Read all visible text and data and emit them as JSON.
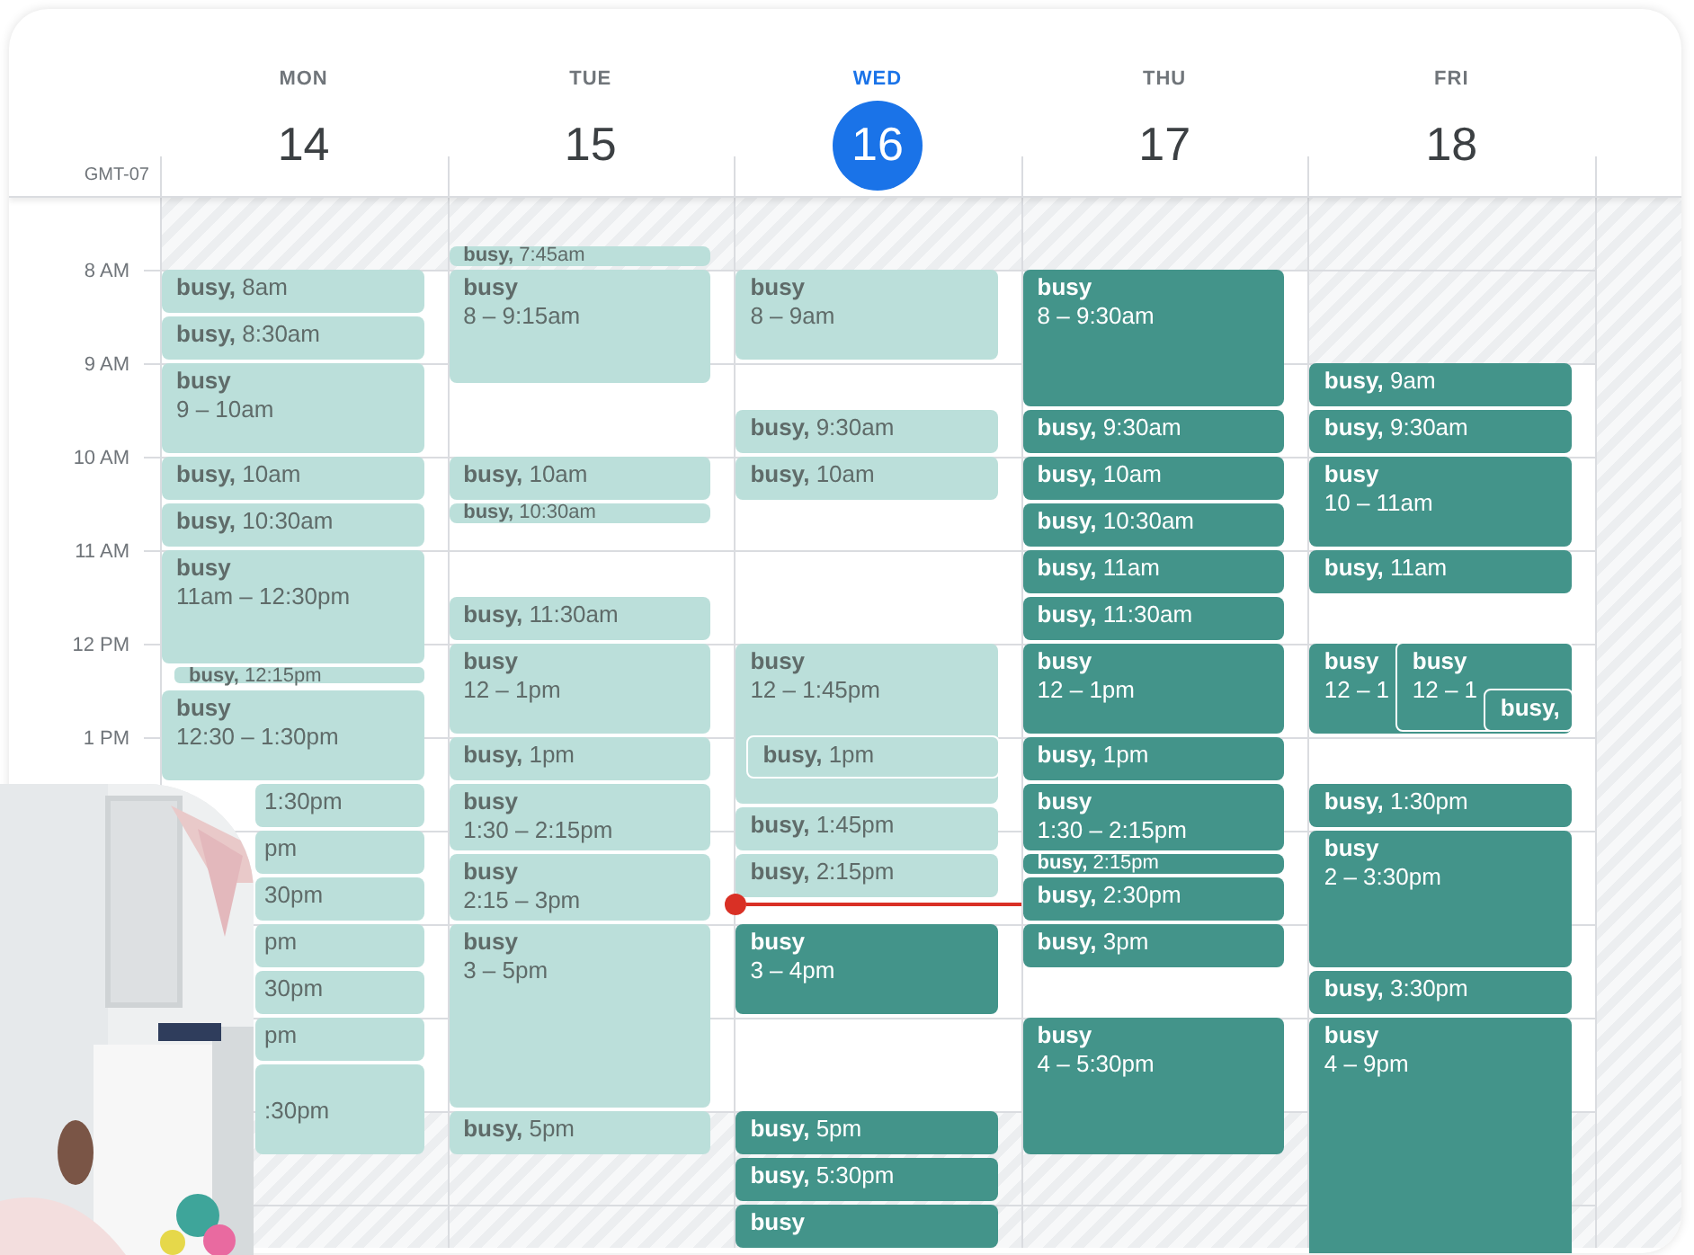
{
  "timezone": "GMT-07",
  "hours": [
    "8 AM",
    "9 AM",
    "10 AM",
    "11 AM",
    "12 PM",
    "1 PM"
  ],
  "days": [
    {
      "name": "MON",
      "date": "14",
      "selected": false,
      "events": [
        {
          "title": "busy,",
          "time": "8am",
          "past": true
        },
        {
          "title": "busy,",
          "time": "8:30am",
          "past": true
        },
        {
          "title": "busy",
          "time": "9 – 10am",
          "past": true
        },
        {
          "title": "busy,",
          "time": "10am",
          "past": true
        },
        {
          "title": "busy,",
          "time": "10:30am",
          "past": true
        },
        {
          "title": "busy",
          "time": "11am – 12:30pm",
          "past": true,
          "children": [
            {
              "title": "busy,",
              "time": "12:15pm",
              "past": true
            }
          ]
        },
        {
          "title": "busy",
          "time": "12:30 – 1:30pm",
          "past": true
        },
        {
          "time": "1:30pm",
          "past": true,
          "covered": true
        },
        {
          "time": "pm",
          "past": true,
          "covered": true
        },
        {
          "time": "30pm",
          "past": true,
          "covered": true
        },
        {
          "time": "pm",
          "past": true,
          "covered": true
        },
        {
          "time": "30pm",
          "past": true,
          "covered": true
        },
        {
          "time": "pm",
          "past": true,
          "covered": true
        },
        {
          "time": ":30pm",
          "past": true,
          "covered": true
        }
      ]
    },
    {
      "name": "TUE",
      "date": "15",
      "selected": false,
      "events": [
        {
          "title": "busy,",
          "time": "7:45am",
          "past": true
        },
        {
          "title": "busy",
          "time": "8 – 9:15am",
          "past": true
        },
        {
          "title": "busy,",
          "time": "10am",
          "past": true
        },
        {
          "title": "busy,",
          "time": "10:30am",
          "past": true
        },
        {
          "title": "busy,",
          "time": "11:30am",
          "past": true
        },
        {
          "title": "busy",
          "time": "12 – 1pm",
          "past": true
        },
        {
          "title": "busy,",
          "time": "1pm",
          "past": true
        },
        {
          "title": "busy",
          "time": "1:30 – 2:15pm",
          "past": true
        },
        {
          "title": "busy",
          "time": "2:15 – 3pm",
          "past": true
        },
        {
          "title": "busy",
          "time": "3 – 5pm",
          "past": true
        },
        {
          "title": "busy,",
          "time": "5pm",
          "past": true
        }
      ]
    },
    {
      "name": "WED",
      "date": "16",
      "selected": true,
      "events": [
        {
          "title": "busy",
          "time": "8 – 9am",
          "past": true
        },
        {
          "title": "busy,",
          "time": "9:30am",
          "past": true
        },
        {
          "title": "busy,",
          "time": "10am",
          "past": true
        },
        {
          "title": "busy",
          "time": "12 – 1:45pm",
          "past": true,
          "children": [
            {
              "title": "busy,",
              "time": "1pm",
              "past": true
            }
          ]
        },
        {
          "title": "busy,",
          "time": "1:45pm",
          "past": true
        },
        {
          "title": "busy,",
          "time": "2:15pm",
          "past": true
        },
        {
          "title": "busy",
          "time": "3 – 4pm",
          "past": false
        },
        {
          "title": "busy,",
          "time": "5pm",
          "past": false
        },
        {
          "title": "busy,",
          "time": "5:30pm",
          "past": false
        },
        {
          "title": "busy",
          "past": false
        }
      ]
    },
    {
      "name": "THU",
      "date": "17",
      "selected": false,
      "events": [
        {
          "title": "busy",
          "time": "8 – 9:30am",
          "past": false
        },
        {
          "title": "busy,",
          "time": "9:30am",
          "past": false
        },
        {
          "title": "busy,",
          "time": "10am",
          "past": false
        },
        {
          "title": "busy,",
          "time": "10:30am",
          "past": false
        },
        {
          "title": "busy,",
          "time": "11am",
          "past": false
        },
        {
          "title": "busy,",
          "time": "11:30am",
          "past": false
        },
        {
          "title": "busy",
          "time": "12 – 1pm",
          "past": false
        },
        {
          "title": "busy,",
          "time": "1pm",
          "past": false
        },
        {
          "title": "busy",
          "time": "1:30 – 2:15pm",
          "past": false
        },
        {
          "title": "busy,",
          "time": "2:15pm",
          "past": false
        },
        {
          "title": "busy,",
          "time": "2:30pm",
          "past": false
        },
        {
          "title": "busy,",
          "time": "3pm",
          "past": false
        },
        {
          "title": "busy",
          "time": "4 – 5:30pm",
          "past": false
        }
      ]
    },
    {
      "name": "FRI",
      "date": "18",
      "selected": false,
      "events": [
        {
          "title": "busy,",
          "time": "9am",
          "past": false
        },
        {
          "title": "busy,",
          "time": "9:30am",
          "past": false
        },
        {
          "title": "busy",
          "time": "10 – 11am",
          "past": false
        },
        {
          "title": "busy,",
          "time": "11am",
          "past": false
        },
        {
          "title": "busy",
          "time": "12 – 1",
          "past": false,
          "children": [
            {
              "title": "busy",
              "time": "12 – 1",
              "past": false,
              "children": [
                {
                  "title": "busy,",
                  "past": false
                }
              ]
            }
          ]
        },
        {
          "title": "busy,",
          "time": "1:30pm",
          "past": false
        },
        {
          "title": "busy",
          "time": "2 – 3:30pm",
          "past": false
        },
        {
          "title": "busy,",
          "time": "3:30pm",
          "past": false
        },
        {
          "title": "busy",
          "time": "4 – 9pm",
          "past": false
        }
      ]
    }
  ]
}
